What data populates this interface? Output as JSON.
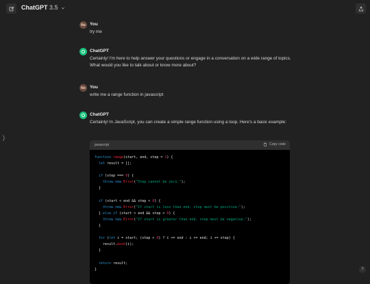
{
  "header": {
    "model_name": "ChatGPT",
    "model_version": "3.5"
  },
  "sidebar": {
    "toggle_glyph": ")"
  },
  "messages": [
    {
      "author": "You",
      "avatar": "No",
      "text": "try me"
    },
    {
      "author": "ChatGPT",
      "text": "Certainly! I'm here to help answer your questions or engage in a conversation on a wide range of topics. What would you like to talk about or know more about?"
    },
    {
      "author": "You",
      "avatar": "No",
      "text": "write me a range function in javascript"
    },
    {
      "author": "ChatGPT",
      "text": "Certainly! In JavaScript, you can create a simple range function using a loop. Here's a basic example:"
    }
  ],
  "code": {
    "language": "javascript",
    "copy_label": "Copy code",
    "lines": [
      "function range(start, end, step = 1) {",
      "  let result = [];",
      "",
      "  if (step === 0) {",
      "    throw new Error(\"Step cannot be zero.\");",
      "  }",
      "",
      "  if (start < end && step < 0) {",
      "    throw new Error(\"If start is less than end, step must be positive.\");",
      "  } else if (start > end && step > 0) {",
      "    throw new Error(\"If start is greater than end, step must be negative.\");",
      "  }",
      "",
      "  for (let i = start; (step > 0) ? i <= end : i >= end; i += step) {",
      "    result.push(i);",
      "  }",
      "",
      "  return result;",
      "}"
    ]
  },
  "help": {
    "label": "?"
  },
  "colors": {
    "background": "#212121",
    "accent": "#19c37d",
    "code_bg": "#000000"
  }
}
